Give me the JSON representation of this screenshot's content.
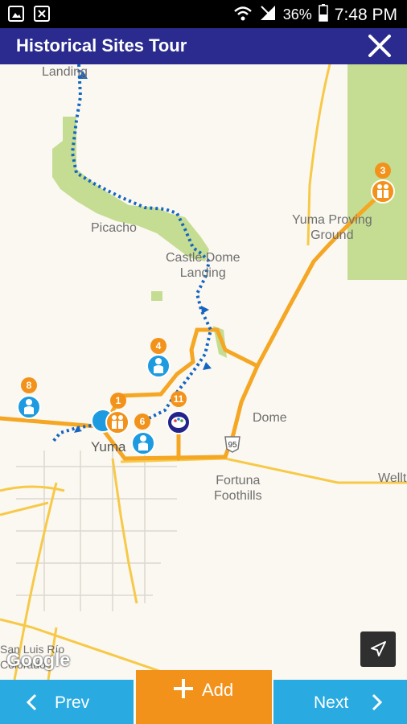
{
  "status_bar": {
    "battery": "36%",
    "time": "7:48 PM"
  },
  "app_bar": {
    "title": "Historical Sites Tour"
  },
  "map": {
    "labels": {
      "landing": "Landing",
      "picacho": "Picacho",
      "castle_dome": "Castle Dome\nLanding",
      "yuma_proving": "Yuma Proving\nGround",
      "yuma": "Yuma",
      "dome": "Dome",
      "fortuna": "Fortuna\nFoothills",
      "wellton": "Wellt",
      "san_luis": "San Luis Río\nColorado",
      "highway": "95"
    },
    "markers": [
      {
        "number": "3",
        "type": "people"
      },
      {
        "number": "4",
        "type": "person"
      },
      {
        "number": "8",
        "type": "person"
      },
      {
        "number": "1",
        "type": "people"
      },
      {
        "number": "6",
        "type": "person"
      },
      {
        "number": "11",
        "type": "art"
      }
    ],
    "attribution": "Google"
  },
  "bottom_bar": {
    "prev_label": "Prev",
    "add_label": "Add",
    "next_label": "Next"
  },
  "colors": {
    "app_bar": "#2a2a8f",
    "nav_button": "#29abe2",
    "add_button": "#f2921a",
    "route": "#1565c0",
    "road": "#f5a623"
  }
}
